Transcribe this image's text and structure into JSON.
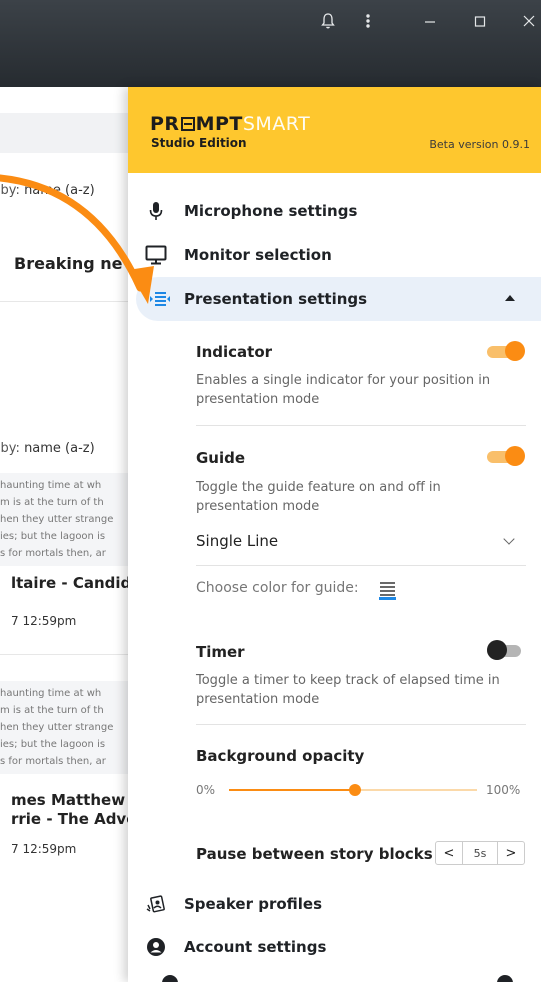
{
  "window": {
    "icons": [
      "bell-icon",
      "more-vertical-icon",
      "minimize-icon",
      "maximize-icon",
      "close-icon"
    ]
  },
  "background_app": {
    "sort_label_1": "ort by:",
    "sort_value_1": "name (a-z)",
    "story_title": "Breaking ne",
    "sort_label_2": "ort by:",
    "sort_value_2": "name (a-z)",
    "items": [
      {
        "snippet": [
          "haunting time at wh",
          "m is at the turn of th",
          "hen they utter strange",
          "ies; but the lagoon is",
          "s for mortals then, ar"
        ],
        "title_lines": [
          "ltaire - Candid"
        ],
        "date": "7 12:59pm"
      },
      {
        "snippet": [
          "haunting time at wh",
          "m is at the turn of th",
          "hen they utter strange",
          "ies; but the lagoon is",
          "s for mortals then, ar"
        ],
        "title_lines": [
          "mes Matthew",
          "rrie - The Adve"
        ],
        "date": "7 12:59pm"
      }
    ]
  },
  "panel": {
    "logo_prompt": "PR",
    "logo_prompt_rest": "MPT",
    "logo_smart": "SMART",
    "edition": "Studio Edition",
    "version": "Beta version 0.9.1",
    "menu": [
      {
        "label": "Microphone settings",
        "icon": "microphone-icon"
      },
      {
        "label": "Monitor selection",
        "icon": "monitor-icon"
      },
      {
        "label": "Presentation settings",
        "icon": "presentation-icon",
        "expanded": true
      }
    ],
    "indicator": {
      "title": "Indicator",
      "description": "Enables a single indicator for your position in presentation mode",
      "enabled": true
    },
    "guide": {
      "title": "Guide",
      "description": "Toggle the guide feature on and off in presentation mode",
      "enabled": true,
      "mode": "Single Line",
      "color_label": "Choose color for guide:",
      "color": "#1e88e5"
    },
    "timer": {
      "title": "Timer",
      "description": "Toggle a timer to keep track of elapsed time in presentation mode",
      "enabled": false
    },
    "opacity": {
      "title": "Background opacity",
      "min_label": "0%",
      "max_label": "100%",
      "value_percent": 51
    },
    "pause": {
      "label": "Pause between story blocks",
      "value": "5s",
      "prev": "<",
      "next": ">"
    },
    "bottom_menu": [
      {
        "label": "Speaker profiles",
        "icon": "speaker-profile-icon"
      },
      {
        "label": "Account settings",
        "icon": "account-icon"
      }
    ]
  },
  "colors": {
    "accent": "#fb8c13",
    "brand_yellow": "#fec72e",
    "active_row": "#e9f0f9",
    "titlebar": "#2e3338"
  }
}
